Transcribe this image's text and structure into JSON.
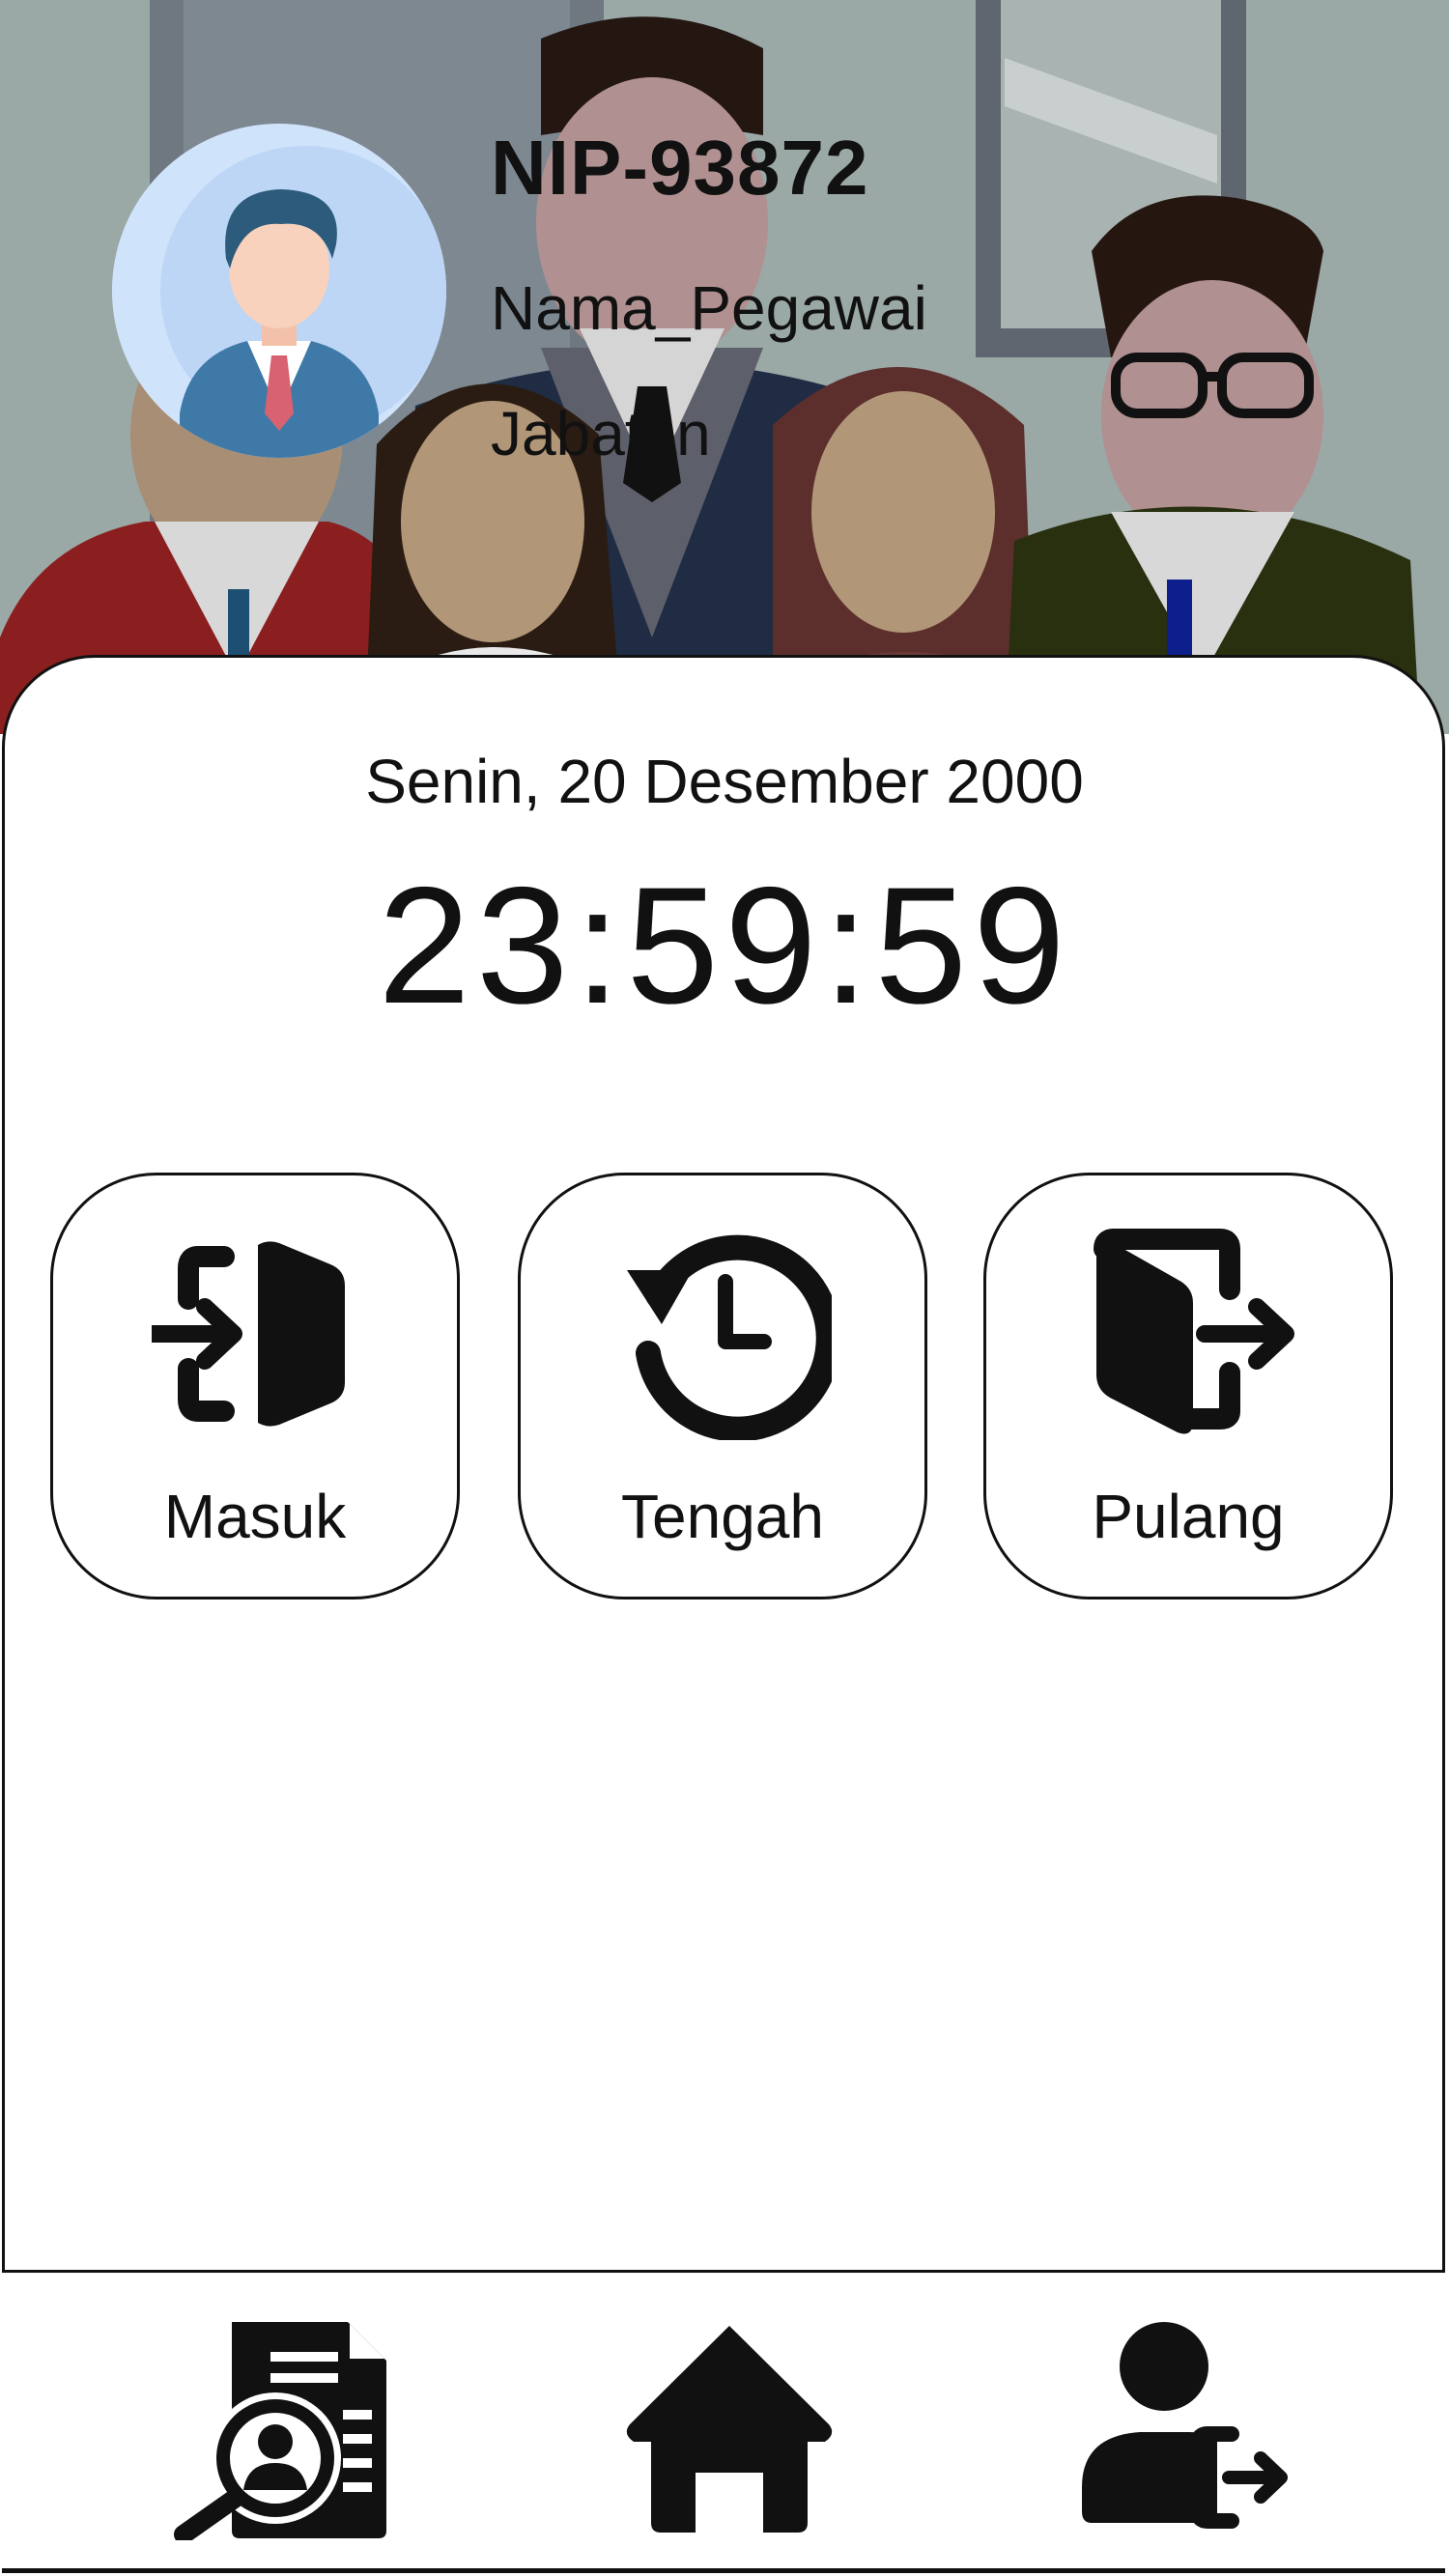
{
  "profile": {
    "nip": "NIP-93872",
    "nama": "Nama_Pegawai",
    "jabatan": "Jabatan",
    "avatar_icon": "employee-avatar"
  },
  "attendance": {
    "date": "Senin, 20 Desember 2000",
    "time": "23:59:59"
  },
  "actions": {
    "masuk": {
      "label": "Masuk",
      "icon": "door-enter-icon"
    },
    "tengah": {
      "label": "Tengah",
      "icon": "history-clock-icon"
    },
    "pulang": {
      "label": "Pulang",
      "icon": "door-exit-icon"
    }
  },
  "nav": {
    "items": [
      {
        "icon": "report-search-icon"
      },
      {
        "icon": "home-icon"
      },
      {
        "icon": "user-logout-icon"
      }
    ]
  },
  "colors": {
    "text": "#111111",
    "avatar_bg": "#cfe3fb",
    "header_bg": "#9aa8a6"
  }
}
